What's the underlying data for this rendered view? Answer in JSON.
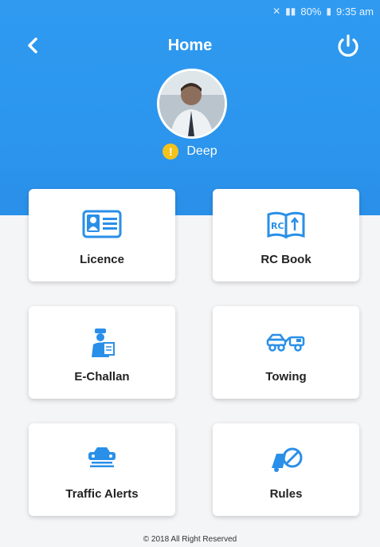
{
  "status_bar": {
    "battery": "80%",
    "time": "9:35 am"
  },
  "header": {
    "title": "Home",
    "user_name": "Deep"
  },
  "cards": [
    {
      "label": "Licence",
      "icon": "id-card-icon"
    },
    {
      "label": "RC Book",
      "icon": "rc-book-icon"
    },
    {
      "label": "E-Challan",
      "icon": "officer-icon"
    },
    {
      "label": "Towing",
      "icon": "tow-truck-icon"
    },
    {
      "label": "Traffic Alerts",
      "icon": "car-alert-icon"
    },
    {
      "label": "Rules",
      "icon": "rules-sign-icon"
    }
  ],
  "footer": {
    "text": "© 2018 All Right Reserved"
  },
  "colors": {
    "primary": "#2c96ee",
    "icon": "#2a8fe8",
    "warning": "#f5c21b"
  }
}
